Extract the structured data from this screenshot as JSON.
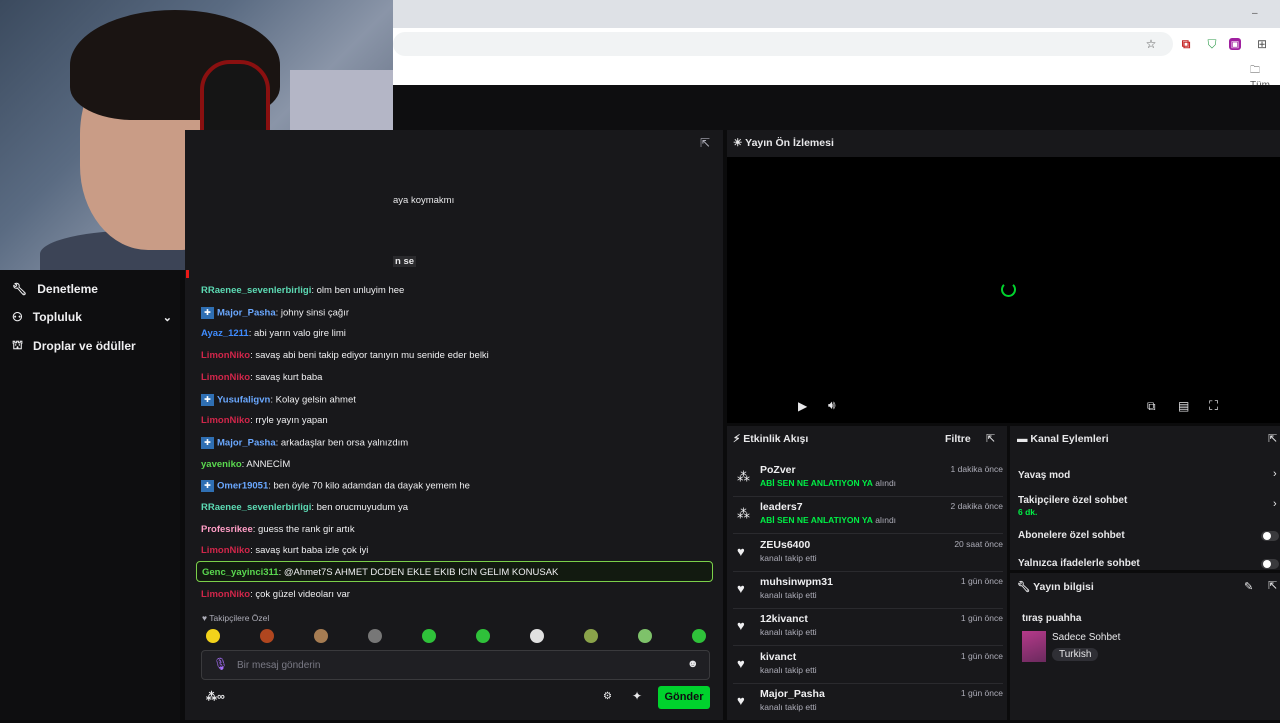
{
  "browser": {
    "bookmarks_label": "Tüm"
  },
  "sidebar": {
    "items": [
      {
        "label": "Denetleme",
        "icon": "wrench-icon"
      },
      {
        "label": "Topluluk",
        "icon": "community-icon"
      },
      {
        "label": "Droplar ve ödüller",
        "icon": "gift-icon"
      }
    ]
  },
  "chat": {
    "partial_messages": [
      "aya koymakmı",
      "n se"
    ],
    "messages": [
      {
        "user": "RRaenee_sevenlerbirligi",
        "color": "#5cd9b3",
        "badge": false,
        "text": ": olm ben unluyim hee"
      },
      {
        "user": "Major_Pasha",
        "color": "#6aa8ff",
        "badge": true,
        "text": ": johny sinsi çağır"
      },
      {
        "user": "Ayaz_1211",
        "color": "#3f8cff",
        "badge": false,
        "text": ": abi yarın valo gire limi"
      },
      {
        "user": "LimonNiko",
        "color": "#d0264a",
        "badge": false,
        "text": ": savaş abi beni takip ediyor tanıyın mu senide eder belki"
      },
      {
        "user": "LimonNiko",
        "color": "#d0264a",
        "badge": false,
        "text": ": savaş kurt baba"
      },
      {
        "user": "Yusufaligvn",
        "color": "#6aa8ff",
        "badge": true,
        "text": ": Kolay gelsin ahmet"
      },
      {
        "user": "LimonNiko",
        "color": "#d0264a",
        "badge": false,
        "text": ": rryle yayın yapan"
      },
      {
        "user": "Major_Pasha",
        "color": "#6aa8ff",
        "badge": true,
        "text": ": arkadaşlar ben orsa yalnızdım"
      },
      {
        "user": "yaveniko",
        "color": "#5ad84f",
        "badge": false,
        "text": ": ANNECİM"
      },
      {
        "user": "Omer19051",
        "color": "#6aa8ff",
        "badge": true,
        "text": ": ben öyle 70 kilo adamdan da dayak yemem he"
      },
      {
        "user": "RRaenee_sevenlerbirligi",
        "color": "#5cd9b3",
        "badge": false,
        "text": ": ben orucmuyudum ya"
      },
      {
        "user": "Profesrikee",
        "color": "#ff9ec6",
        "badge": false,
        "text": ": guess the rank gir artık"
      },
      {
        "user": "LimonNiko",
        "color": "#d0264a",
        "badge": false,
        "text": ": savaş kurt baba izle çok iyi"
      },
      {
        "user": "Genc_yayinci311",
        "color": "#5ad84f",
        "badge": false,
        "text": ": @Ahmet7S AHMET DCDEN EKLE EKIB ICIN GELIM KONUSAK"
      },
      {
        "user": "LimonNiko",
        "color": "#d0264a",
        "badge": false,
        "text": ": çok güzel videoları var"
      }
    ],
    "followers_only": "Takipçilere Özel",
    "input_placeholder": "Bir mesaj gönderin",
    "points": "∞",
    "send_label": "Gönder"
  },
  "preview": {
    "title": "Yayın Ön İzlemesi"
  },
  "activity": {
    "title": "Etkinlik Akışı",
    "filter": "Filtre",
    "items": [
      {
        "name": "PoZver",
        "reward": "ABİ SEN NE ANLATIYON YA",
        "suffix": " alındı",
        "time": "1 dakika önce",
        "icon": "points-icon"
      },
      {
        "name": "leaders7",
        "reward": "ABİ SEN NE ANLATIYON YA",
        "suffix": " alındı",
        "time": "2 dakika önce",
        "icon": "points-icon"
      },
      {
        "name": "ZEUs6400",
        "reward": "",
        "suffix": "kanalı takip etti",
        "time": "20 saat önce",
        "icon": "heart-icon"
      },
      {
        "name": "muhsinwpm31",
        "reward": "",
        "suffix": "kanalı takip etti",
        "time": "1 gün önce",
        "icon": "heart-icon"
      },
      {
        "name": "12kivanct",
        "reward": "",
        "suffix": "kanalı takip etti",
        "time": "1 gün önce",
        "icon": "heart-icon"
      },
      {
        "name": "kivanct",
        "reward": "",
        "suffix": "kanalı takip etti",
        "time": "1 gün önce",
        "icon": "heart-icon"
      },
      {
        "name": "Major_Pasha",
        "reward": "",
        "suffix": "kanalı takip etti",
        "time": "1 gün önce",
        "icon": "heart-icon"
      }
    ]
  },
  "channel_actions": {
    "title": "Kanal Eylemleri",
    "slow_mode": "Yavaş mod",
    "followers_chat": "Takipçilere özel sohbet",
    "followers_chat_value": "6 dk.",
    "subs_chat": "Abonelere özel sohbet",
    "emote_chat": "Yalnızca ifadelerle sohbet"
  },
  "stream_info": {
    "title": "Yayın bilgisi",
    "stream_title": "tıraş puahha",
    "category": "Sadece Sohbet",
    "language": "Turkish"
  }
}
